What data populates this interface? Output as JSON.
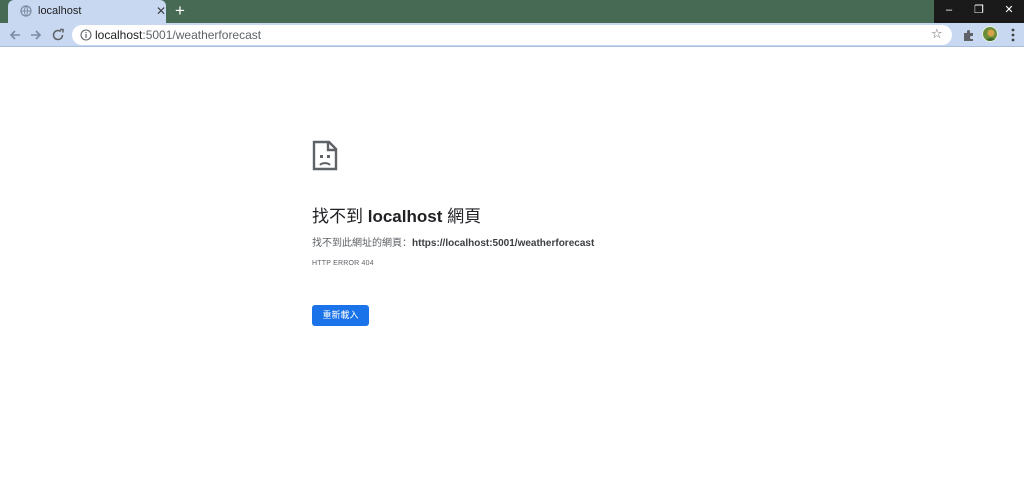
{
  "browser": {
    "tab": {
      "title": "localhost"
    },
    "new_tab_icon": "plus-icon",
    "window_buttons": {
      "minimize": "–",
      "restore": "❐",
      "close": "✕"
    },
    "omnibox": {
      "host": "localhost",
      "path": ":5001/weatherforecast"
    }
  },
  "error_page": {
    "title_prefix": "找不到 ",
    "title_host": "localhost",
    "title_suffix": " 網頁",
    "description_prefix": "找不到此網址的網頁：",
    "description_url": "https://localhost:5001/weatherforecast",
    "error_code": "HTTP ERROR 404",
    "reload_label": "重新載入"
  },
  "colors": {
    "tabstrip_bg": "#476a54",
    "toolbar_bg": "#c8d8f0",
    "accent": "#1a73e8"
  }
}
